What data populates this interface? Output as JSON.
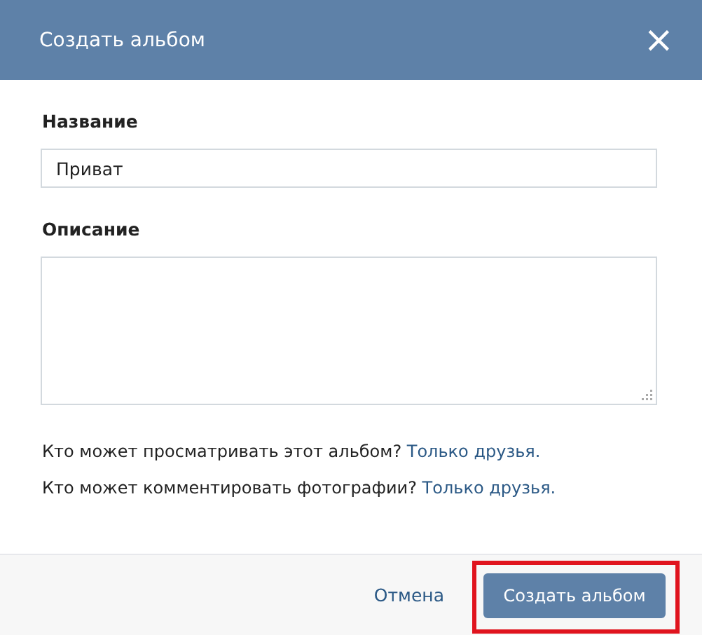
{
  "dialog": {
    "title": "Создать альбом",
    "close": "×"
  },
  "fields": [
    {
      "kind": "input",
      "label": "Название",
      "value": "Приват"
    },
    {
      "kind": "textarea",
      "label": "Описание"
    }
  ],
  "privacy": [
    {
      "question": "Кто может просматривать этот альбом?",
      "link": "Только друзья."
    },
    {
      "question": "Кто может комментировать фотографии?",
      "link": "Только друзья."
    }
  ],
  "footer": {
    "cancel": "Отмена",
    "submit": "Создать альбом",
    "submit_highlighted": true
  }
}
